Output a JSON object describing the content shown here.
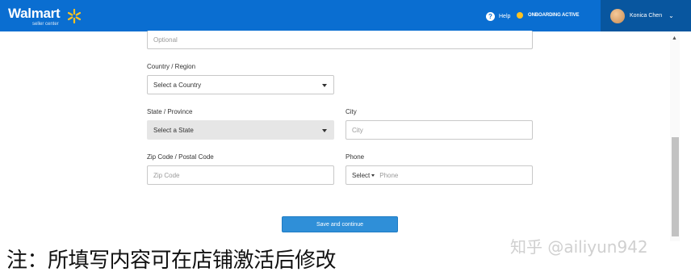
{
  "header": {
    "brand": "Walmart",
    "brand_sub": "seller center",
    "help_label": "Help",
    "status_label": "ONBOARDING ACTIVE",
    "user_name": "Konica Chen"
  },
  "form": {
    "address2_placeholder": "Optional",
    "country_label": "Country / Region",
    "country_value": "Select a Country",
    "state_label": "State / Province",
    "state_value": "Select a State",
    "city_label": "City",
    "city_placeholder": "City",
    "zip_label": "Zip Code / Postal Code",
    "zip_placeholder": "Zip Code",
    "phone_label": "Phone",
    "phone_prefix": "Select",
    "phone_placeholder": "Phone",
    "save_label": "Save and continue"
  },
  "caption": "注：所填写内容可在店铺激活后修改",
  "watermark": "知乎 @ailiyun942",
  "colors": {
    "header_bg": "#0a6ed1",
    "user_bg": "#08569f",
    "spark": "#ffc220",
    "button": "#2f8fd8"
  }
}
